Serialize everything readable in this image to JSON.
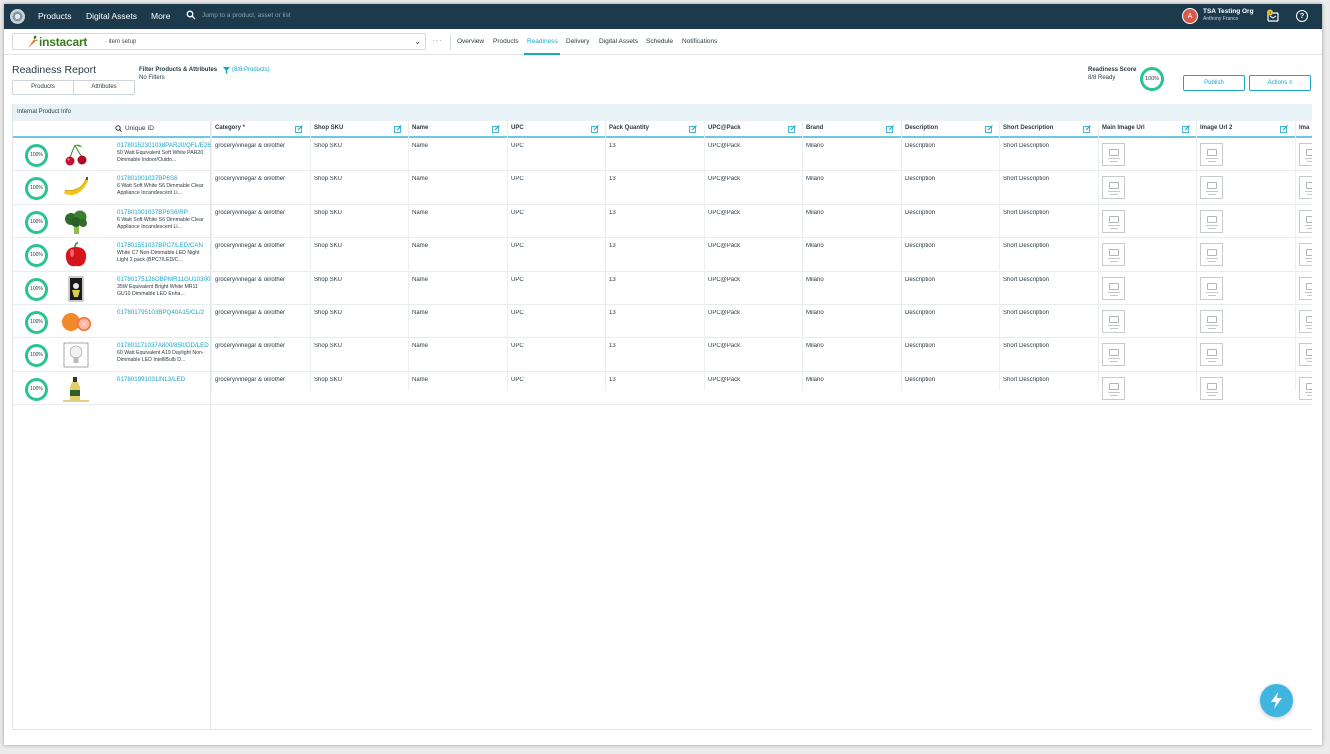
{
  "topnav": {
    "nav": [
      "Products",
      "Digital Assets",
      "More"
    ],
    "search_placeholder": "Jump to a product, asset or list",
    "avatar_initial": "A",
    "org_name": "TSA Testing Org",
    "user_name": "Anthony Franco",
    "notification_count": "3",
    "help_label": "?"
  },
  "subbar": {
    "brand": "instacart",
    "context": "· item setup",
    "more": "···",
    "tabs": [
      "Overview",
      "Products",
      "Readiness",
      "Delivery",
      "Digital Assets",
      "Schedule",
      "Notifications"
    ],
    "active_tab": "Readiness"
  },
  "report": {
    "title": "Readiness Report",
    "segments": [
      "Products",
      "Attributes"
    ],
    "filter_label": "Filter Products & Attributes",
    "filter_count": "(8/8 Products)",
    "filter_status": "No Filters",
    "score_label": "Readiness Score",
    "score_ready": "8/8 Ready",
    "score_value": "100%",
    "publish": "Publish",
    "actions": "Actions"
  },
  "grid": {
    "section": "Internal Product Info",
    "uid_header": "Unique ID",
    "columns": [
      "Category *",
      "Shop SKU",
      "Name",
      "UPC",
      "Pack Quantity",
      "UPC@Pack",
      "Brand",
      "Description",
      "Short Description",
      "Main Image Url",
      "Image Url 2",
      "Ima"
    ],
    "rows": [
      {
        "score": "100%",
        "thumb": "cherries-icon",
        "uid": "01780152301038PAR20/QFL/E26/1",
        "desc": "50 Watt Equivalent Soft White PAR20 Dimmable Indoor/Outdo...",
        "category": "grocery/vinegar & oil/other",
        "sku": "Shop SKU",
        "name": "Name",
        "upc": "UPC",
        "pack": "13",
        "upcpack": "UPC@Pack",
        "brand": "Milano",
        "description": "Description",
        "short": "Short Description"
      },
      {
        "score": "100%",
        "thumb": "banana-icon",
        "uid": "017801001037BP6S6",
        "desc": "6 Watt Soft White S6 Dimmable Clear Appliance Incandescent Li...",
        "category": "grocery/vinegar & oil/other",
        "sku": "Shop SKU",
        "name": "Name",
        "upc": "UPC",
        "pack": "13",
        "upcpack": "UPC@Pack",
        "brand": "Milano",
        "description": "Description",
        "short": "Short Description"
      },
      {
        "score": "100%",
        "thumb": "broccoli-icon",
        "uid": "017801001037BP6S6/RP",
        "desc": "6 Watt Soft White S6 Dimmable Clear Appliance Incandescent Li...",
        "category": "grocery/vinegar & oil/other",
        "sku": "Shop SKU",
        "name": "Name",
        "upc": "UPC",
        "pack": "13",
        "upcpack": "UPC@Pack",
        "brand": "Milano",
        "description": "Description",
        "short": "Short Description"
      },
      {
        "score": "100%",
        "thumb": "bell-pepper-icon",
        "uid": "017801551037BPC7/LED/CAN",
        "desc": "White C7 Non-Dimmable LED Night Light 2 pack (BPC7/LED/C...",
        "category": "grocery/vinegar & oil/other",
        "sku": "Shop SKU",
        "name": "Name",
        "upc": "UPC",
        "pack": "13",
        "upcpack": "UPC@Pack",
        "brand": "Milano",
        "description": "Description",
        "short": "Short Description"
      },
      {
        "score": "100%",
        "thumb": "chips-can-icon",
        "uid": "01780175126OBPMR11GU10300S",
        "desc": "35W Equivalent Bright White MR11 GU10 Dimmable LED Enha...",
        "category": "grocery/vinegar & oil/other",
        "sku": "Shop SKU",
        "name": "Name",
        "upc": "UPC",
        "pack": "13",
        "upcpack": "UPC@Pack",
        "brand": "Milano",
        "description": "Description",
        "short": "Short Description"
      },
      {
        "score": "100%",
        "thumb": "grapefruit-icon",
        "uid": "017801795103BPQ40A15/CL/2",
        "desc": "",
        "category": "grocery/vinegar & oil/other",
        "sku": "Shop SKU",
        "name": "Name",
        "upc": "UPC",
        "pack": "13",
        "upcpack": "UPC@Pack",
        "brand": "Milano",
        "description": "Description",
        "short": "Short Description"
      },
      {
        "score": "100%",
        "thumb": "light-bulb-icon",
        "uid": "017801171037A800/850/DD/LED",
        "desc": "60 Watt Equivalent A19 Daylight Non-Dimmable LED IntelliBulb D...",
        "category": "grocery/vinegar & oil/other",
        "sku": "Shop SKU",
        "name": "Name",
        "upc": "UPC",
        "pack": "13",
        "upcpack": "UPC@Pack",
        "brand": "Milano",
        "description": "Description",
        "short": "Short Description"
      },
      {
        "score": "100%",
        "thumb": "oil-bottle-icon",
        "uid": "017801991031INL3/LED",
        "desc": "",
        "category": "grocery/vinegar & oil/other",
        "sku": "Shop SKU",
        "name": "Name",
        "upc": "UPC",
        "pack": "13",
        "upcpack": "UPC@Pack",
        "brand": "Milano",
        "description": "Description",
        "short": "Short Description"
      }
    ]
  },
  "fab": {
    "icon": "lightning-icon"
  },
  "colors": {
    "accent": "#18a6c9",
    "nav_bg": "#1d3a4c",
    "ready_green": "#2bc48d",
    "brand_green": "#3a7a23"
  }
}
